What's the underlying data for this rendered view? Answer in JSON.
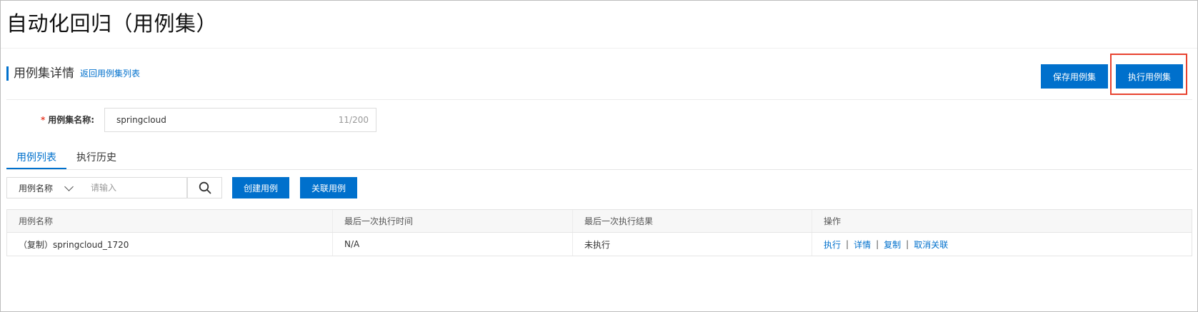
{
  "page": {
    "title": "自动化回归（用例集）"
  },
  "section": {
    "title": "用例集详情",
    "back_link": "返回用例集列表"
  },
  "header_actions": {
    "save_label": "保存用例集",
    "run_label": "执行用例集"
  },
  "form": {
    "name_required_mark": "*",
    "name_label": "用例集名称:",
    "name_value": "springcloud",
    "name_count": "11/200"
  },
  "tabs": [
    {
      "label": "用例列表",
      "active": true
    },
    {
      "label": "执行历史",
      "active": false
    }
  ],
  "filter": {
    "select_value": "用例名称",
    "search_placeholder": "请输入",
    "create_label": "创建用例",
    "link_label": "关联用例"
  },
  "table": {
    "columns": [
      "用例名称",
      "最后一次执行时间",
      "最后一次执行结果",
      "操作"
    ],
    "rows": [
      {
        "name": "（复制）springcloud_1720",
        "last_run_time": "N/A",
        "last_run_result": "未执行",
        "actions": [
          "执行",
          "详情",
          "复制",
          "取消关联"
        ]
      }
    ],
    "action_separator": "|"
  },
  "colors": {
    "primary": "#0070cc",
    "highlight": "#e8422f",
    "required": "#e8422f"
  }
}
